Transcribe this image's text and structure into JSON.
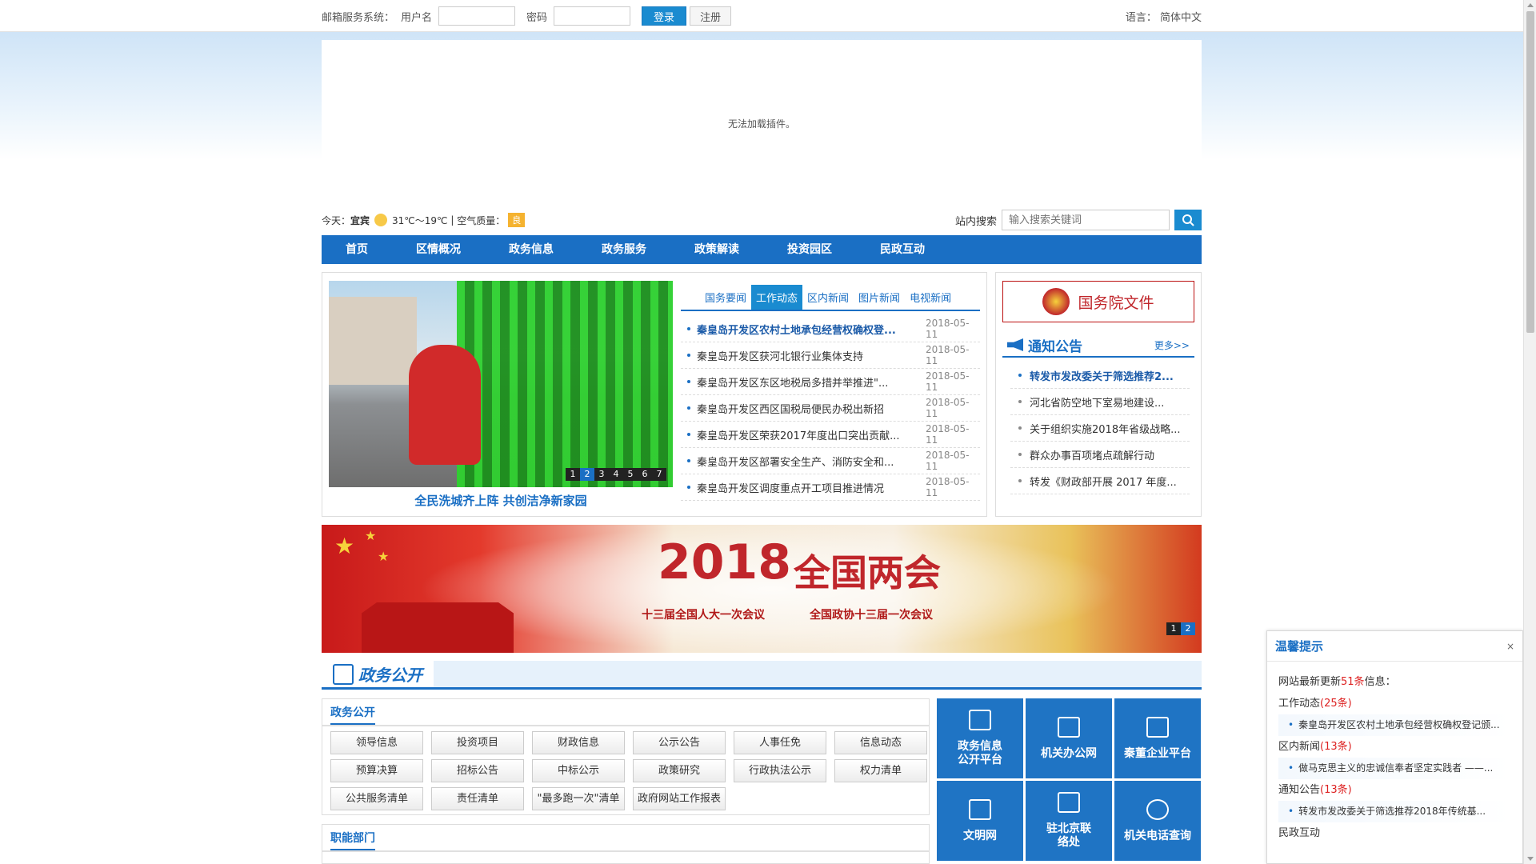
{
  "login": {
    "system_label": "邮箱服务系统：",
    "username_label": "用户名",
    "password_label": "密码",
    "login_button": "登录",
    "register_button": "注册",
    "language": "语言： 简体中文"
  },
  "plugin": {
    "message": "无法加载插件。"
  },
  "weather": {
    "today_label": "今天：",
    "city": "宜宾",
    "temperature": "31℃～19℃",
    "air_label": "空气质量：",
    "air_badge": "良"
  },
  "search": {
    "label": "站内搜索",
    "placeholder": "输入搜索关键词"
  },
  "nav": [
    "首页",
    "区情概况",
    "政务信息",
    "政务服务",
    "政策解读",
    "投资园区",
    "民政互动"
  ],
  "carousel": {
    "caption": "全民洗城齐上阵 共创洁净新家园",
    "pages": [
      "1",
      "2",
      "3",
      "4",
      "5",
      "6",
      "7"
    ],
    "active_page": 2
  },
  "news": {
    "tabs": [
      "国务要闻",
      "工作动态",
      "区内新闻",
      "图片新闻",
      "电视新闻"
    ],
    "active_tab": 1,
    "items": [
      {
        "title": "秦皇岛开发区农村土地承包经营权确权登...",
        "date": "2018-05-11"
      },
      {
        "title": "秦皇岛开发区获河北银行业集体支持",
        "date": "2018-05-11"
      },
      {
        "title": "秦皇岛开发区东区地税局多措并举推进\"...",
        "date": "2018-05-11"
      },
      {
        "title": "秦皇岛开发区西区国税局便民办税出新招",
        "date": "2018-05-11"
      },
      {
        "title": "秦皇岛开发区荣获2017年度出口突出贡献...",
        "date": "2018-05-11"
      },
      {
        "title": "秦皇岛开发区部署安全生产、消防安全和...",
        "date": "2018-05-11"
      },
      {
        "title": "秦皇岛开发区调度重点开工项目推进情况",
        "date": "2018-05-11"
      }
    ]
  },
  "right": {
    "state_council": "国务院文件",
    "notice_title": "通知公告",
    "more": "更多>>",
    "notices": [
      "转发市发改委关于筛选推荐2...",
      "河北省防空地下室易地建设...",
      "关于组织实施2018年省级战略...",
      "群众办事百项堵点疏解行动",
      "转发《财政部开展 2017 年度..."
    ]
  },
  "banner": {
    "year": "2018",
    "title": "全国两会",
    "sub1": "十三届全国人大一次会议",
    "sub2": "全国政协十三届一次会议",
    "pages": [
      "1",
      "2"
    ],
    "active_page": 2
  },
  "section": {
    "title": "政务公开"
  },
  "gov_open": {
    "title": "政务公开",
    "buttons": [
      "领导信息",
      "投资项目",
      "财政信息",
      "公示公告",
      "人事任免",
      "信息动态",
      "预算决算",
      "招标公告",
      "中标公示",
      "政策研究",
      "行政执法公示",
      "权力清单",
      "公共服务清单",
      "责任清单",
      "\"最多跑一次\"清单",
      "政府网站工作报表"
    ]
  },
  "departments": {
    "title": "职能部门"
  },
  "tiles": [
    {
      "label": "政务信息\n公开平台",
      "icon": "chat-icon"
    },
    {
      "label": "机关办公网",
      "icon": "list-icon"
    },
    {
      "label": "秦董企业平台",
      "icon": "edit-icon"
    },
    {
      "label": "文明网",
      "icon": "book-icon"
    },
    {
      "label": "驻北京联\n络处",
      "icon": "phone-icon"
    },
    {
      "label": "机关电话查询",
      "icon": "search-icon"
    }
  ],
  "popup": {
    "title": "温馨提示",
    "close": "×",
    "summary_pre": "网站最新更新",
    "summary_count": "51条",
    "summary_post": "信息：",
    "groups": [
      {
        "name": "工作动态",
        "count": "(25条)",
        "item": "秦皇岛开发区农村土地承包经营权确权登记颁..."
      },
      {
        "name": "区内新闻",
        "count": "(13条)",
        "item": "做马克思主义的忠诚信奉者坚定实践者 ——..."
      },
      {
        "name": "通知公告",
        "count": "(13条)",
        "item": "转发市发改委关于筛选推荐2018年传统基..."
      },
      {
        "name": "民政互动",
        "count": "",
        "item": ""
      }
    ]
  },
  "colors": {
    "primary": "#1a6fc4",
    "accent": "#1a8bd0",
    "highlight": "#c0262b"
  }
}
